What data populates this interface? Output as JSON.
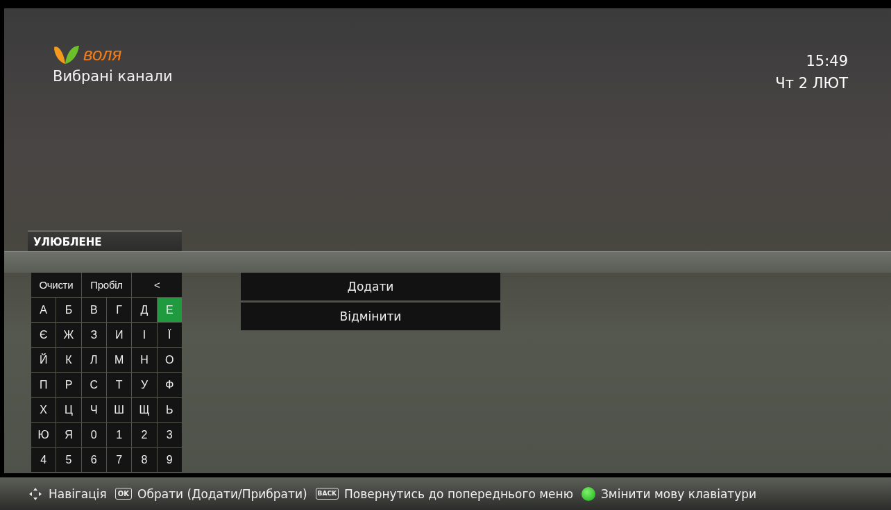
{
  "header": {
    "logo_text": "воля",
    "title": "Вибрані канали",
    "time": "15:49",
    "date": "Чт 2 ЛЮТ"
  },
  "section_tab": {
    "label": "УЛЮБЛЕНЕ"
  },
  "keyboard": {
    "function_keys": [
      {
        "label": "Очисти",
        "selected": false
      },
      {
        "label": "Пробіл",
        "selected": false
      },
      {
        "label": "<",
        "selected": false
      }
    ],
    "rows": [
      [
        {
          "label": "А",
          "selected": false
        },
        {
          "label": "Б",
          "selected": false
        },
        {
          "label": "В",
          "selected": false
        },
        {
          "label": "Г",
          "selected": false
        },
        {
          "label": "Д",
          "selected": false
        },
        {
          "label": "Е",
          "selected": true
        }
      ],
      [
        {
          "label": "Є",
          "selected": false
        },
        {
          "label": "Ж",
          "selected": false
        },
        {
          "label": "З",
          "selected": false
        },
        {
          "label": "И",
          "selected": false
        },
        {
          "label": "І",
          "selected": false
        },
        {
          "label": "Ї",
          "selected": false
        }
      ],
      [
        {
          "label": "Й",
          "selected": false
        },
        {
          "label": "К",
          "selected": false
        },
        {
          "label": "Л",
          "selected": false
        },
        {
          "label": "М",
          "selected": false
        },
        {
          "label": "Н",
          "selected": false
        },
        {
          "label": "О",
          "selected": false
        }
      ],
      [
        {
          "label": "П",
          "selected": false
        },
        {
          "label": "Р",
          "selected": false
        },
        {
          "label": "С",
          "selected": false
        },
        {
          "label": "Т",
          "selected": false
        },
        {
          "label": "У",
          "selected": false
        },
        {
          "label": "Ф",
          "selected": false
        }
      ],
      [
        {
          "label": "Х",
          "selected": false
        },
        {
          "label": "Ц",
          "selected": false
        },
        {
          "label": "Ч",
          "selected": false
        },
        {
          "label": "Ш",
          "selected": false
        },
        {
          "label": "Щ",
          "selected": false
        },
        {
          "label": "Ь",
          "selected": false
        }
      ],
      [
        {
          "label": "Ю",
          "selected": false
        },
        {
          "label": "Я",
          "selected": false
        },
        {
          "label": "0",
          "selected": false
        },
        {
          "label": "1",
          "selected": false
        },
        {
          "label": "2",
          "selected": false
        },
        {
          "label": "3",
          "selected": false
        }
      ],
      [
        {
          "label": "4",
          "selected": false
        },
        {
          "label": "5",
          "selected": false
        },
        {
          "label": "6",
          "selected": false
        },
        {
          "label": "7",
          "selected": false
        },
        {
          "label": "8",
          "selected": false
        },
        {
          "label": "9",
          "selected": false
        }
      ]
    ]
  },
  "actions": [
    {
      "label": "Додати"
    },
    {
      "label": "Відмінити"
    }
  ],
  "hints": [
    {
      "kind": "dpad",
      "text": "Навігація"
    },
    {
      "kind": "key",
      "key_label": "OK",
      "text": "Обрати (Додати/Прибрати)"
    },
    {
      "kind": "key",
      "key_label": "BACK",
      "text": "Повернутись до попереднього меню"
    },
    {
      "kind": "green",
      "text": "Змінити мову клавіатури"
    }
  ]
}
